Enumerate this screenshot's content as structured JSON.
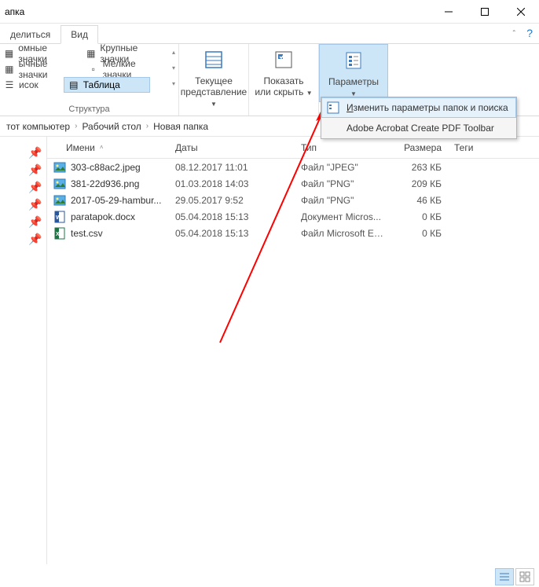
{
  "title": "апка",
  "tabs": {
    "share": "делиться",
    "view": "Вид"
  },
  "ribbon": {
    "view_items": {
      "huge_icons": "омные значки",
      "large_icons": "Крупные значки",
      "medium_icons": "ычные значки",
      "small_icons": "Мелкие значки",
      "list": "исок",
      "table": "Таблица"
    },
    "structure_label": "Структура",
    "current_view": "Текущее\nпредставление",
    "show_hide": "Показать\nили скрыть",
    "parameters": "Параметры"
  },
  "dropdown": {
    "change_params_prefix": "И",
    "change_params_rest": "зменить параметры папок и поиска",
    "adobe": "Adobe Acrobat Create PDF Toolbar"
  },
  "breadcrumb": {
    "pc": "тот компьютер",
    "desktop": "Рабочий стол",
    "folder": "Новая папка"
  },
  "columns": {
    "name": "Имени",
    "date": "Даты",
    "type": "Тип",
    "size": "Размера",
    "tags": "Теги"
  },
  "files": [
    {
      "icon": "img",
      "name": "303-c88ac2.jpeg",
      "date": "08.12.2017 11:01",
      "type": "Файл \"JPEG\"",
      "size": "263 КБ"
    },
    {
      "icon": "img",
      "name": "381-22d936.png",
      "date": "01.03.2018 14:03",
      "type": "Файл \"PNG\"",
      "size": "209 КБ"
    },
    {
      "icon": "img",
      "name": "2017-05-29-hambur...",
      "date": "29.05.2017 9:52",
      "type": "Файл \"PNG\"",
      "size": "46 КБ"
    },
    {
      "icon": "doc",
      "name": "paratapok.docx",
      "date": "05.04.2018 15:13",
      "type": "Документ Micros...",
      "size": "0 КБ"
    },
    {
      "icon": "xls",
      "name": "test.csv",
      "date": "05.04.2018 15:13",
      "type": "Файл Microsoft Ex...",
      "size": "0 КБ"
    }
  ]
}
